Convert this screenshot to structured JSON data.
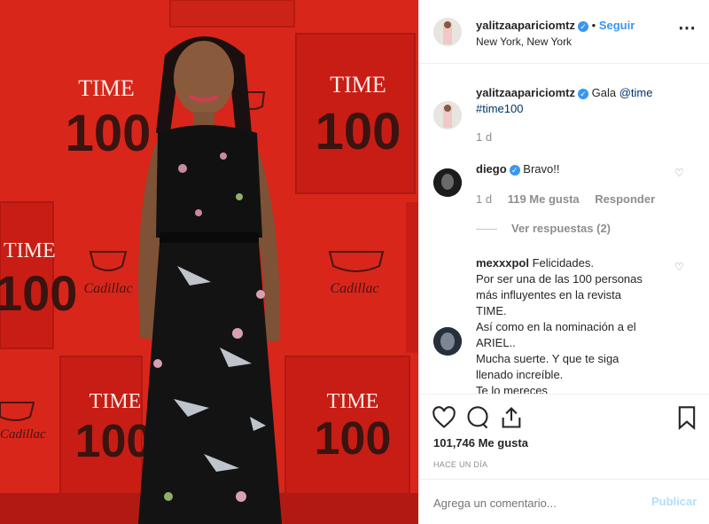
{
  "photo": {
    "brand_word": "TIME",
    "brand_number": "100",
    "sponsor": "Cadillac"
  },
  "header": {
    "username": "yalitzaapariciomtz",
    "follow_separator": "•",
    "follow_label": "Seguir",
    "location": "New York, New York",
    "more_icon": "⋯"
  },
  "caption": {
    "username": "yalitzaapariciomtz",
    "text": "Gala",
    "mention": "@time",
    "hashtag": "#time100",
    "time": "1 d"
  },
  "comments": [
    {
      "username": "diego",
      "text": "Bravo!!",
      "time": "1 d",
      "likes": "119 Me gusta",
      "reply": "Responder",
      "view_replies": "Ver respuestas (2)"
    },
    {
      "username": "mexxxpol",
      "lines": [
        "Felicidades.",
        "Por ser una de las 100 personas",
        "más influyentes en la revista",
        "TIME.",
        "Así como en la nominación a el",
        "ARIEL..",
        "Mucha suerte. Y que te siga",
        "llenado increíble.",
        "Te lo mereces"
      ]
    }
  ],
  "actions": {
    "likes": "101,746 Me gusta",
    "timestamp": "HACE UN DÍA"
  },
  "add_comment": {
    "placeholder": "Agrega un comentario...",
    "publish": "Publicar"
  },
  "colors": {
    "accent": "#3897f0",
    "backdrop_red": "#d8261b",
    "panel_red": "#c81d15"
  }
}
